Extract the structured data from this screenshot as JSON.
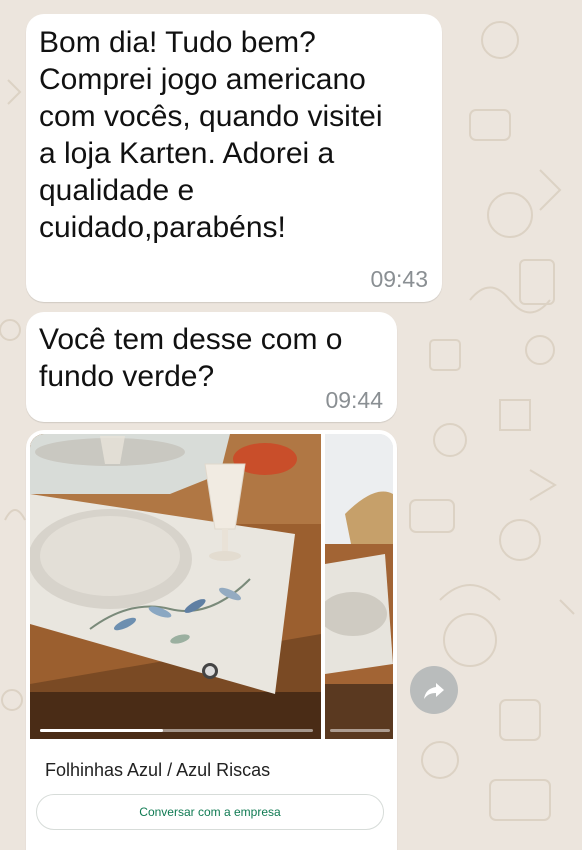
{
  "messages": [
    {
      "text": "Bom dia! Tudo bem?\nComprei jogo americano\ncom vocês, quando visitei\na loja Karten. Adorei a\nqualidade e\ncuidado,parabéns!",
      "time": "09:43"
    },
    {
      "text": "Você tem desse com o\nfundo verde?",
      "time": "09:44"
    }
  ],
  "product_card": {
    "title": "Folhinhas Azul / Azul Riscas",
    "cta_label": "Conversar com a empresa",
    "image_progress": 0.45
  },
  "icons": {
    "forward": "forward-arrow-icon"
  },
  "colors": {
    "chat_background": "#ece5dd",
    "bubble": "#ffffff",
    "cta_text": "#0f7a52",
    "timestamp": "#8a8f93"
  }
}
